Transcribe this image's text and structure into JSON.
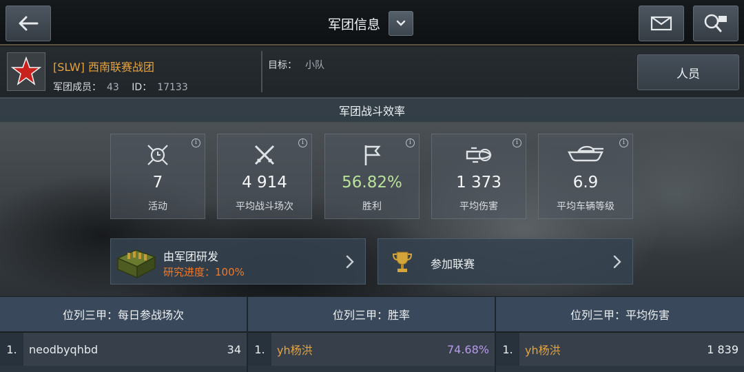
{
  "header": {
    "title": "军团信息",
    "back_icon": "back-arrow-icon",
    "dropdown_icon": "chevron-down-icon",
    "mail_icon": "mail-icon",
    "search_icon": "search-icon"
  },
  "clan": {
    "name": "[SLW] 西南联赛战团",
    "members_label": "军团成员：",
    "members_value": "43",
    "id_label": "ID：",
    "id_value": "17133",
    "target_label": "目标：",
    "target_value": "小队",
    "members_button": "人员",
    "emblem_icon": "red-star-emblem",
    "name_color": "#e7a33a"
  },
  "efficiency": {
    "title": "军团战斗效率",
    "stats": [
      {
        "icon": "clock-crossed-swords-icon",
        "value": "7",
        "label": "活动"
      },
      {
        "icon": "crossed-swords-icon",
        "value": "4 914",
        "label": "平均战斗场次"
      },
      {
        "icon": "flag-icon",
        "value": "56.82%",
        "label": "胜利"
      },
      {
        "icon": "shell-icon",
        "value": "1 373",
        "label": "平均伤害"
      },
      {
        "icon": "tank-icon",
        "value": "6.9",
        "label": "平均车辆等级"
      }
    ]
  },
  "panels": {
    "research": {
      "title": "由军团研发",
      "progress_label": "研究进度：100%",
      "progress": 1.0,
      "icon": "ammo-crate-icon"
    },
    "league": {
      "title": "参加联赛",
      "icon": "trophy-icon"
    }
  },
  "leaderboards": [
    {
      "title": "位列三甲：每日参战场次",
      "rows": [
        {
          "rank": "1.",
          "name": "neodbyqhbd",
          "value": "34"
        }
      ]
    },
    {
      "title": "位列三甲：胜率",
      "rows": [
        {
          "rank": "1.",
          "name": "yh杨洪",
          "value": "74.68%"
        }
      ]
    },
    {
      "title": "位列三甲：平均伤害",
      "rows": [
        {
          "rank": "1.",
          "name": "yh杨洪",
          "value": "1 839"
        }
      ]
    }
  ],
  "colors": {
    "accent_orange": "#e7a33a",
    "progress_orange": "#ef7a2c",
    "winrate_green": "#b9e29a",
    "winrate_purple": "#b79ae8"
  }
}
